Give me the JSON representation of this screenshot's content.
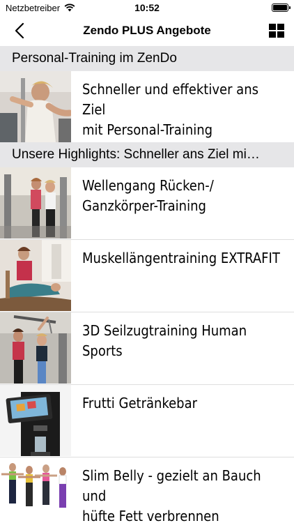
{
  "status": {
    "carrier": "Netzbetreiber",
    "time": "10:52"
  },
  "nav": {
    "title": "Zendo PLUS Angebote"
  },
  "sections": [
    {
      "header": "Personal-Training im ZenDo"
    },
    {
      "header": "Unsere Highlights: Schneller ans Ziel mi…"
    }
  ],
  "items": [
    {
      "title": "Schneller und effektiver ans Ziel mit Personal-Training",
      "line1": "Schneller und effektiver ans Ziel",
      "line2": "mit Personal-Training"
    },
    {
      "line1": "Wellengang Rücken-/",
      "line2": "Ganzkörper-Training"
    },
    {
      "line1": "Muskellängentraining EXTRAFIT",
      "line2": ""
    },
    {
      "line1": "3D Seilzugtraining Human Sports",
      "line2": ""
    },
    {
      "line1": "Frutti Getränkebar",
      "line2": ""
    },
    {
      "line1": "Slim Belly - gezielt an Bauch und",
      "line2": "hüfte Fett verbrennen"
    }
  ]
}
